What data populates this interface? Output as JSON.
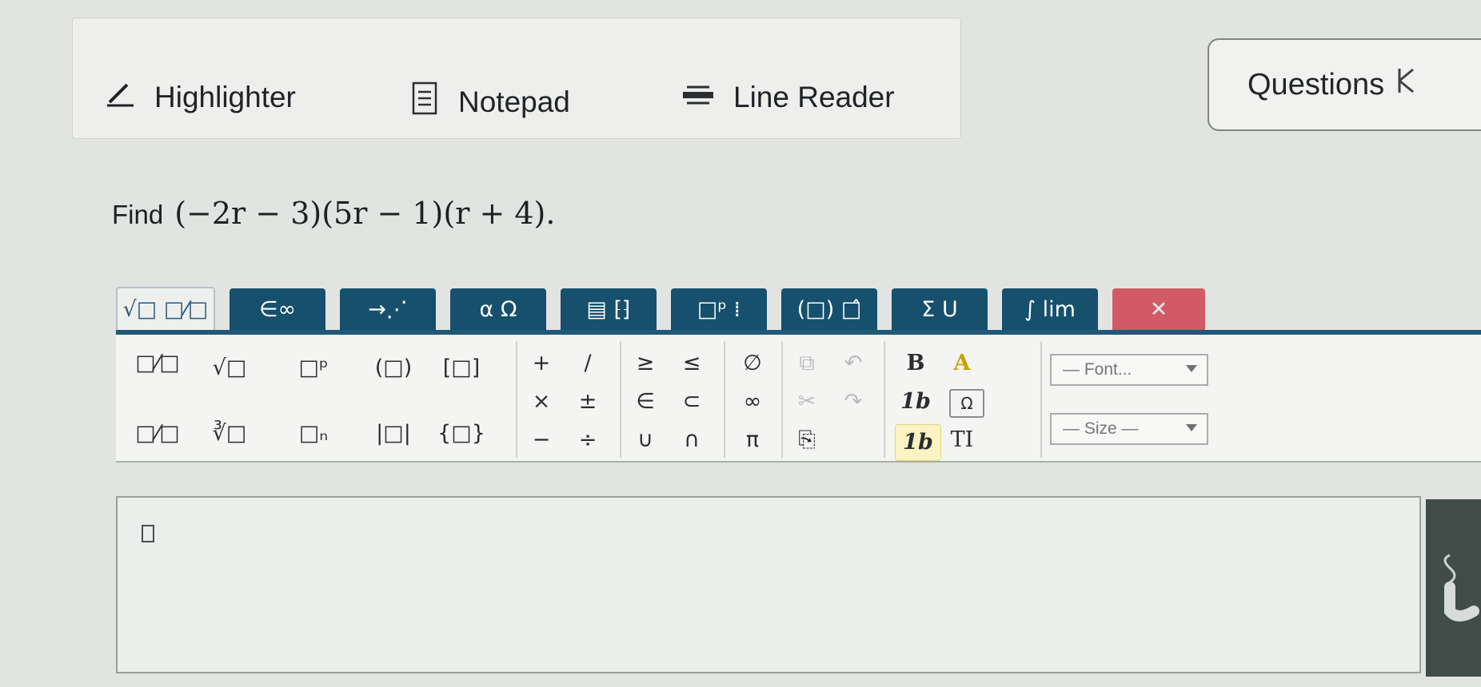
{
  "toolbar": {
    "highlighter_label": "Highlighter",
    "notepad_label": "Notepad",
    "line_reader_label": "Line Reader",
    "questions_label": "Questions"
  },
  "question": {
    "prefix": "Find",
    "expression": "(−2r − 3)(5r − 1)(r + 4)."
  },
  "editor": {
    "tabs": [
      {
        "label": "√□ □⁄□",
        "active": true
      },
      {
        "label": "∈∞"
      },
      {
        "label": "→⋰"
      },
      {
        "label": "α Ω"
      },
      {
        "label": "▤ ⁅⁆"
      },
      {
        "label": "□ᵖ ⁞"
      },
      {
        "label": "(□) □̂"
      },
      {
        "label": "Σ U"
      },
      {
        "label": "∫ lim"
      },
      {
        "label": "✕"
      }
    ],
    "palette": {
      "math": [
        "□⁄□",
        "√□",
        "□ᵖ",
        "(□)",
        "[□]",
        "□⁄□",
        "∛□",
        "□ₙ",
        "|□|",
        "{□}"
      ],
      "ops": [
        "+",
        "/",
        "×",
        "±",
        "−",
        "÷"
      ],
      "sets": [
        "≥",
        "≤",
        "∈",
        "⊂",
        "∪",
        "∩"
      ],
      "misc": [
        "∅",
        "∞",
        "π"
      ],
      "edit": [
        "⧉",
        "↶",
        "✂",
        "↷",
        "⎘"
      ],
      "format": [
        "B",
        "A",
        "1b",
        "Ω",
        "1b",
        "TI"
      ],
      "font_select": "— Font...",
      "size_select": "— Size —"
    }
  },
  "colors": {
    "tab_blue": "#16506d",
    "close_red": "#d25a66",
    "page_bg": "#e2e4e2"
  },
  "icons": {
    "highlighter": "pencil-icon",
    "notepad": "notepad-icon",
    "line_reader": "line-reader-icon",
    "questions": "k-arrow-icon"
  }
}
